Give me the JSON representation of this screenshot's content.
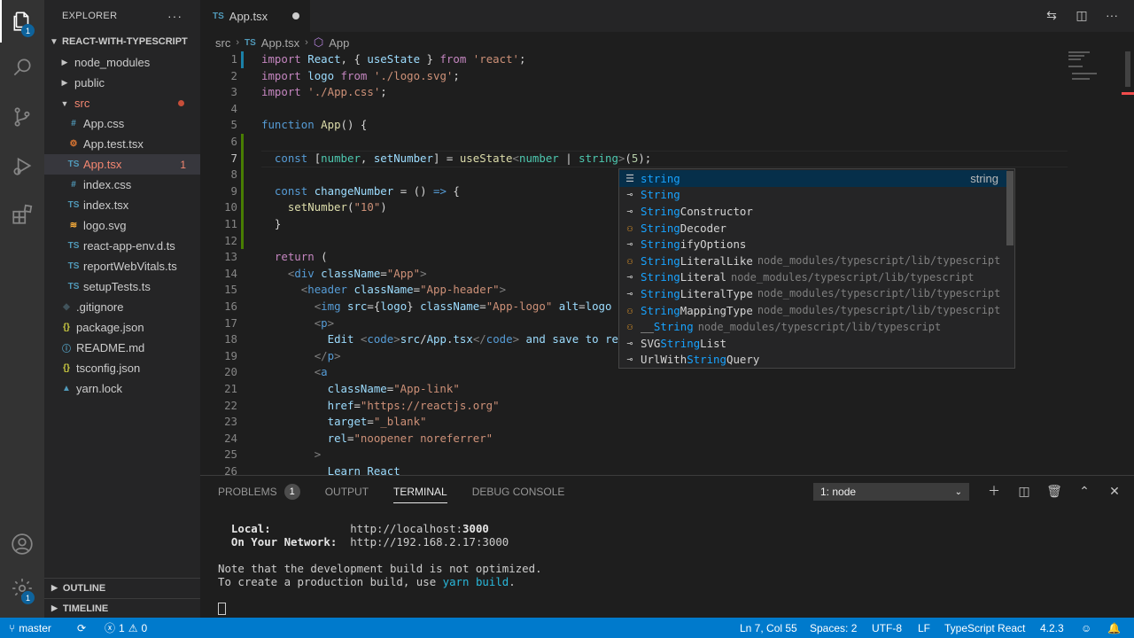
{
  "activity_bar": {
    "explorer_badge": "1",
    "settings_badge": "1"
  },
  "sidebar": {
    "title": "EXPLORER",
    "project": "REACT-WITH-TYPESCRIPT",
    "items": [
      {
        "label": "node_modules",
        "kind": "folder"
      },
      {
        "label": "public",
        "kind": "folder"
      },
      {
        "label": "src",
        "kind": "folder-open"
      },
      {
        "label": "App.css",
        "icon": "#"
      },
      {
        "label": "App.test.tsx",
        "icon": "⚙"
      },
      {
        "label": "App.tsx",
        "icon": "TS",
        "errors": "1"
      },
      {
        "label": "index.css",
        "icon": "#"
      },
      {
        "label": "index.tsx",
        "icon": "TS"
      },
      {
        "label": "logo.svg",
        "icon": "≋"
      },
      {
        "label": "react-app-env.d.ts",
        "icon": "TS"
      },
      {
        "label": "reportWebVitals.ts",
        "icon": "TS"
      },
      {
        "label": "setupTests.ts",
        "icon": "TS"
      },
      {
        "label": ".gitignore",
        "icon": "◆"
      },
      {
        "label": "package.json",
        "icon": "{}"
      },
      {
        "label": "README.md",
        "icon": "ⓘ"
      },
      {
        "label": "tsconfig.json",
        "icon": "{}"
      },
      {
        "label": "yarn.lock",
        "icon": "▲"
      }
    ],
    "outline": "OUTLINE",
    "timeline": "TIMELINE"
  },
  "tab": {
    "icon": "TS",
    "label": "App.tsx"
  },
  "breadcrumb": {
    "folder": "src",
    "file_icon": "TS",
    "file": "App.tsx",
    "symbol": "App"
  },
  "line_numbers": [
    "1",
    "2",
    "3",
    "4",
    "5",
    "6",
    "7",
    "8",
    "9",
    "10",
    "11",
    "12",
    "13",
    "14",
    "15",
    "16",
    "17",
    "18",
    "19",
    "20",
    "21",
    "22",
    "23",
    "24",
    "25",
    "26"
  ],
  "code_lines": [
    "import React, { useState } from 'react';",
    "import logo from './logo.svg';",
    "import './App.css';",
    "",
    "function App() {",
    "",
    "  const [number, setNumber] = useState<number | string>(5);",
    "",
    "  const changeNumber = () => {",
    "    setNumber(\"10\")",
    "  }",
    "",
    "  return (",
    "    <div className=\"App\">",
    "      <header className=\"App-header\">",
    "        <img src={logo} className=\"App-logo\" alt=\"logo",
    "        <p>",
    "          Edit <code>src/App.tsx</code> and save to re",
    "        </p>",
    "        <a",
    "          className=\"App-link\"",
    "          href=\"https://reactjs.org\"",
    "          target=\"_blank\"",
    "          rel=\"noopener noreferrer\"",
    "        >",
    "          Learn React"
  ],
  "suggestions": [
    {
      "match": "string",
      "rest": "",
      "detail": "",
      "right": "string",
      "icon": "keyword"
    },
    {
      "match": "String",
      "rest": "",
      "detail": "",
      "right": "",
      "icon": "interface"
    },
    {
      "match": "String",
      "rest": "Constructor",
      "detail": "",
      "right": "",
      "icon": "interface"
    },
    {
      "match": "String",
      "rest": "Decoder",
      "detail": "",
      "right": "",
      "icon": "class"
    },
    {
      "match": "String",
      "rest": "ifyOptions",
      "detail": "",
      "right": "",
      "icon": "interface"
    },
    {
      "match": "String",
      "rest": "LiteralLike",
      "detail": "node_modules/typescript/lib/typescript",
      "right": "",
      "icon": "class"
    },
    {
      "match": "String",
      "rest": "Literal",
      "detail": "node_modules/typescript/lib/typescript",
      "right": "",
      "icon": "interface"
    },
    {
      "match": "String",
      "rest": "LiteralType",
      "detail": "node_modules/typescript/lib/typescript",
      "right": "",
      "icon": "interface"
    },
    {
      "match": "String",
      "rest": "MappingType",
      "detail": "node_modules/typescript/lib/typescript",
      "right": "",
      "icon": "class"
    },
    {
      "pre": "__",
      "match": "String",
      "rest": "",
      "detail": "node_modules/typescript/lib/typescript",
      "right": "",
      "icon": "class"
    },
    {
      "pre": "SVG",
      "match": "String",
      "rest": "List",
      "detail": "",
      "right": "",
      "icon": "interface"
    },
    {
      "pre": "UrlWith",
      "match": "String",
      "rest": "Query",
      "detail": "",
      "right": "",
      "icon": "interface"
    }
  ],
  "panel": {
    "tabs": {
      "problems": "PROBLEMS",
      "problems_count": "1",
      "output": "OUTPUT",
      "terminal": "TERMINAL",
      "debug": "DEBUG CONSOLE"
    },
    "terminal_select": "1: node",
    "terminal": {
      "local_label": "Local:",
      "local_url_prefix": "http://localhost:",
      "local_port": "3000",
      "network_label": "On Your Network:",
      "network_url": "http://192.168.2.17:3000",
      "note1": "Note that the development build is not optimized.",
      "note2_prefix": "To create a production build, use ",
      "note2_cmd": "yarn build",
      "note2_suffix": "."
    }
  },
  "status": {
    "branch": "master",
    "errors": "1",
    "warnings": "0",
    "position": "Ln 7, Col 55",
    "spaces": "Spaces: 2",
    "encoding": "UTF-8",
    "eol": "LF",
    "language": "TypeScript React",
    "ts_version": "4.2.3"
  }
}
